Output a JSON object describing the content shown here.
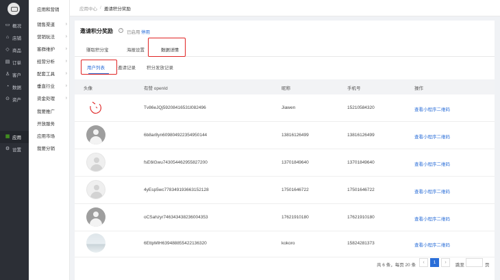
{
  "sidebar": {
    "items": [
      {
        "icon": "monitor-icon",
        "label": "概况"
      },
      {
        "icon": "store-icon",
        "label": "店铺"
      },
      {
        "icon": "tag-icon",
        "label": "商品"
      },
      {
        "icon": "order-icon",
        "label": "订单"
      },
      {
        "icon": "user-icon",
        "label": "客户"
      },
      {
        "icon": "chart-icon",
        "label": "数据"
      },
      {
        "icon": "asset-icon",
        "label": "资产"
      },
      {
        "icon": "apps-icon",
        "label": "应用"
      },
      {
        "icon": "gear-icon",
        "label": "设置"
      }
    ]
  },
  "subnav": {
    "title": "应用和营销",
    "items": [
      {
        "label": "销售渠道",
        "arrow": "›"
      },
      {
        "label": "营销玩法",
        "arrow": "›"
      },
      {
        "label": "客群维护",
        "arrow": "›"
      },
      {
        "label": "经营分析",
        "arrow": "›"
      },
      {
        "label": "配套工具",
        "arrow": "›"
      },
      {
        "label": "垂直行业",
        "arrow": "›"
      },
      {
        "label": "资金处理",
        "arrow": "›"
      },
      {
        "label": "我要推广",
        "arrow": ""
      },
      {
        "label": "开放服务",
        "arrow": ""
      },
      {
        "label": "应用市场",
        "arrow": ""
      },
      {
        "label": "我要分销",
        "arrow": ""
      }
    ]
  },
  "breadcrumb": {
    "parent": "应用中心",
    "separator": "/",
    "current": "邀请积分奖励"
  },
  "header": {
    "title": "邀请积分奖励",
    "status": "已启用",
    "action": "停用"
  },
  "tabs": [
    {
      "label": "赚取积分宝"
    },
    {
      "label": "海报设置"
    },
    {
      "label": "数据详情"
    }
  ],
  "subtabs": [
    {
      "label": "用户列表"
    },
    {
      "label": "邀请记录"
    },
    {
      "label": "积分发放记录"
    }
  ],
  "table": {
    "headers": [
      "头像",
      "有赞 openId",
      "昵称",
      "手机号",
      "操作"
    ],
    "rows": [
      {
        "avatar": "sketch",
        "openid": "Tv86eJQj59208416531l082496",
        "nick": "Jiawen",
        "phone": "15210584320",
        "action": "查看小程序二维码"
      },
      {
        "avatar": "dark",
        "openid": "6b8ar8yn609804922354950144",
        "nick": "13816126499",
        "phone": "13816126499",
        "action": "查看小程序二维码"
      },
      {
        "avatar": "light",
        "openid": "fsE6lGwu743054462955827200",
        "nick": "13701849640",
        "phone": "13701849640",
        "action": "查看小程序二维码"
      },
      {
        "avatar": "light",
        "openid": "4yEsp5wc778349193663152128",
        "nick": "17501646722",
        "phone": "17501646722",
        "action": "查看小程序二维码"
      },
      {
        "avatar": "dark",
        "openid": "oCSahzyr746343438236004353",
        "nick": "17621910180",
        "phone": "17621910180",
        "action": "查看小程序二维码"
      },
      {
        "avatar": "scene",
        "openid": "6EttpMlH639488855422136320",
        "nick": "kokoro",
        "phone": "15824281373",
        "action": "查看小程序二维码"
      }
    ]
  },
  "pagination": {
    "total_text": "共 6 条，每页 20 条",
    "prev": "‹",
    "current_page": "1",
    "next": "›",
    "jump_label": "跳至",
    "page_label": "页"
  },
  "colors": {
    "accent": "#2a6ed8",
    "highlight": "#e02020",
    "sidebar_bg": "#2c2f36",
    "active_icon": "#52c41a"
  }
}
